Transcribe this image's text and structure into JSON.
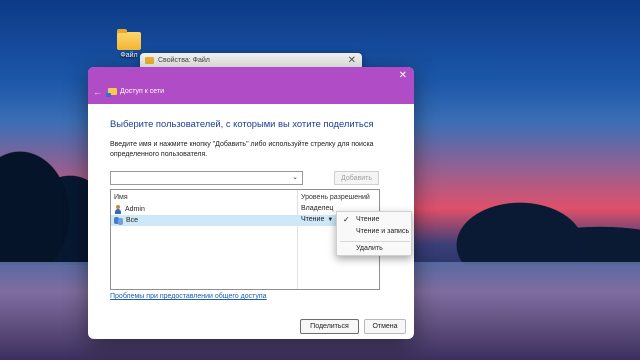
{
  "desktop": {
    "folder_label": "Файл"
  },
  "background_window": {
    "title": "Свойства: Файл",
    "close_glyph": "✕"
  },
  "dialog": {
    "close_glyph": "✕",
    "back_glyph": "←",
    "header_title": "Доступ к сети",
    "heading": "Выберите пользователей, с которыми вы хотите поделиться",
    "instructions": "Введите имя и нажмите кнопку \"Добавить\" либо используйте стрелку для поиска определенного пользователя.",
    "name_input": {
      "value": "",
      "placeholder": ""
    },
    "combo_chevron": "⌄",
    "add_button": "Добавить",
    "table": {
      "headers": {
        "name": "Имя",
        "permission": "Уровень разрешений"
      },
      "rows": [
        {
          "name": "Admin",
          "permission": "Владелец",
          "icon": "user-icon",
          "selected": false
        },
        {
          "name": "Все",
          "permission": "Чтение",
          "icon": "group-icon",
          "selected": true
        }
      ],
      "caret": "▼"
    },
    "problems_link": "Проблемы при предоставлении общего доступа",
    "share_button": "Поделиться",
    "cancel_button": "Отмена"
  },
  "permission_menu": {
    "items": [
      {
        "label": "Чтение",
        "checked": true
      },
      {
        "label": "Чтение и запись",
        "checked": false
      },
      {
        "label": "Удалить",
        "checked": false
      }
    ],
    "check_glyph": "✓"
  },
  "colors": {
    "header_accent": "#b04dc6",
    "heading_blue": "#1b3f92",
    "link_blue": "#1a5fb4",
    "selection": "#cde8f8"
  }
}
